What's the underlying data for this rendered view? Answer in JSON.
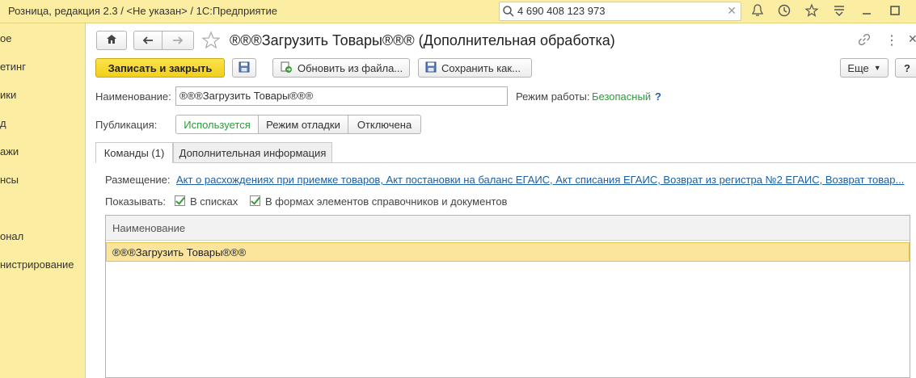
{
  "topbar": {
    "app_title": "Розница, редакция 2.3 / <Не указан> / 1С:Предприятие",
    "search_value": "4 690 408 123 973",
    "icons": [
      "search-icon",
      "bell-icon",
      "history-icon",
      "star-icon",
      "menu-icon",
      "maximize-icon"
    ]
  },
  "sidebar": {
    "items": [
      {
        "label": "ое"
      },
      {
        "label": "етинг"
      },
      {
        "label": "ики"
      },
      {
        "label": "д"
      },
      {
        "label": "ажи"
      },
      {
        "label": "нсы"
      },
      {
        "label": "онал"
      },
      {
        "label": "нистрирование"
      }
    ]
  },
  "doc": {
    "title": "®®®Загрузить Товары®®® (Дополнительная обработка)"
  },
  "toolbar": {
    "save_close": "Записать и закрыть",
    "update_from_file": "Обновить из файла...",
    "save_as": "Сохранить как...",
    "more": "Еще",
    "help": "?"
  },
  "form": {
    "name_label": "Наименование:",
    "name_value": "®®®Загрузить Товары®®®",
    "mode_label": "Режим работы:",
    "mode_value": "Безопасный",
    "mode_help": "?",
    "publication_label": "Публикация:",
    "publication_options": [
      "Используется",
      "Режим отладки",
      "Отключена"
    ]
  },
  "tabs": [
    {
      "label": "Команды (1)",
      "active": true
    },
    {
      "label": "Дополнительная информация",
      "active": false
    }
  ],
  "commands": {
    "placement_label": "Размещение:",
    "placement_value": "Акт о расхождениях при приемке товаров, Акт постановки на баланс ЕГАИС, Акт списания ЕГАИС, Возврат из регистра №2 ЕГАИС, Возврат товар...",
    "show_label": "Показывать:",
    "show_in_lists": "В списках",
    "show_in_forms": "В формах элементов справочников и документов",
    "table_header": "Наименование",
    "rows": [
      "®®®Загрузить Товары®®®"
    ]
  },
  "colors": {
    "accent_yellow": "#f9d93c",
    "sidebar_bg": "#fbeea3",
    "link": "#1b5fa8",
    "green": "#2e9b3a"
  }
}
